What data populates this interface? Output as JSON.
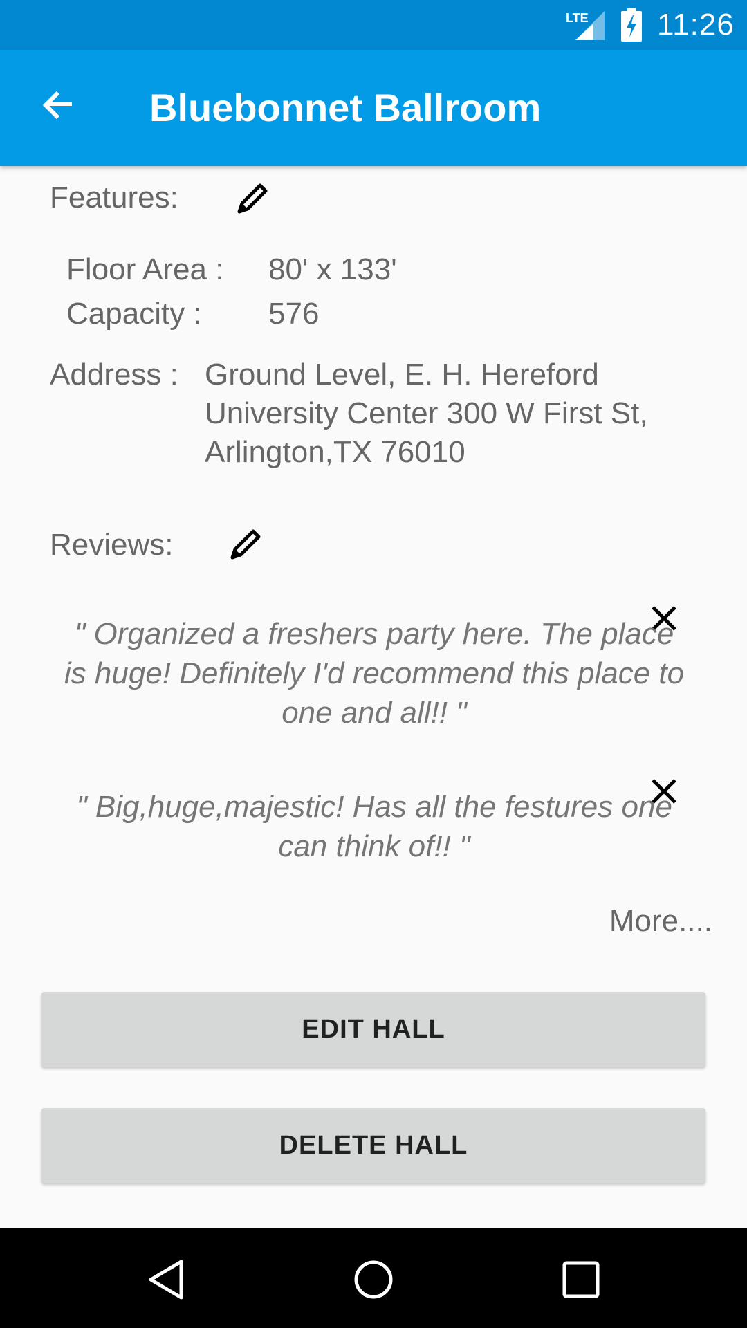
{
  "status_bar": {
    "network": "LTE",
    "time": "11:26"
  },
  "app_bar": {
    "title": "Bluebonnet Ballroom",
    "back_icon": "arrow-back-icon"
  },
  "features": {
    "heading": "Features:",
    "edit_icon": "pencil-icon",
    "floor_area_label": "Floor Area :",
    "floor_area_value": "80' x 133'",
    "capacity_label": "Capacity :",
    "capacity_value": "576"
  },
  "address": {
    "label": "Address :",
    "lines": [
      "Ground Level, E. H. Hereford",
      "University Center 300 W First St,",
      "Arlington,TX 76010"
    ]
  },
  "reviews": {
    "heading": "Reviews:",
    "edit_icon": "pencil-icon",
    "items": [
      {
        "lines": [
          " \" Organized a freshers party here. The place",
          "is huge! Definitely I'd recommend this place to",
          "one and all!!  \""
        ],
        "remove_icon": "close-icon"
      },
      {
        "lines": [
          "\" Big,huge,majestic! Has all the festures one",
          "can think of!!  \""
        ],
        "remove_icon": "close-icon"
      }
    ],
    "more_label": "More...."
  },
  "buttons": {
    "edit_label": "EDIT HALL",
    "delete_label": "DELETE HALL"
  },
  "nav_bar": {
    "back_icon": "nav-back-icon",
    "home_icon": "nav-home-icon",
    "recents_icon": "nav-recents-icon"
  },
  "colors": {
    "status_bar": "#0288d1",
    "app_bar": "#039be5",
    "button": "#d6d7d7",
    "text_secondary": "#666666"
  }
}
